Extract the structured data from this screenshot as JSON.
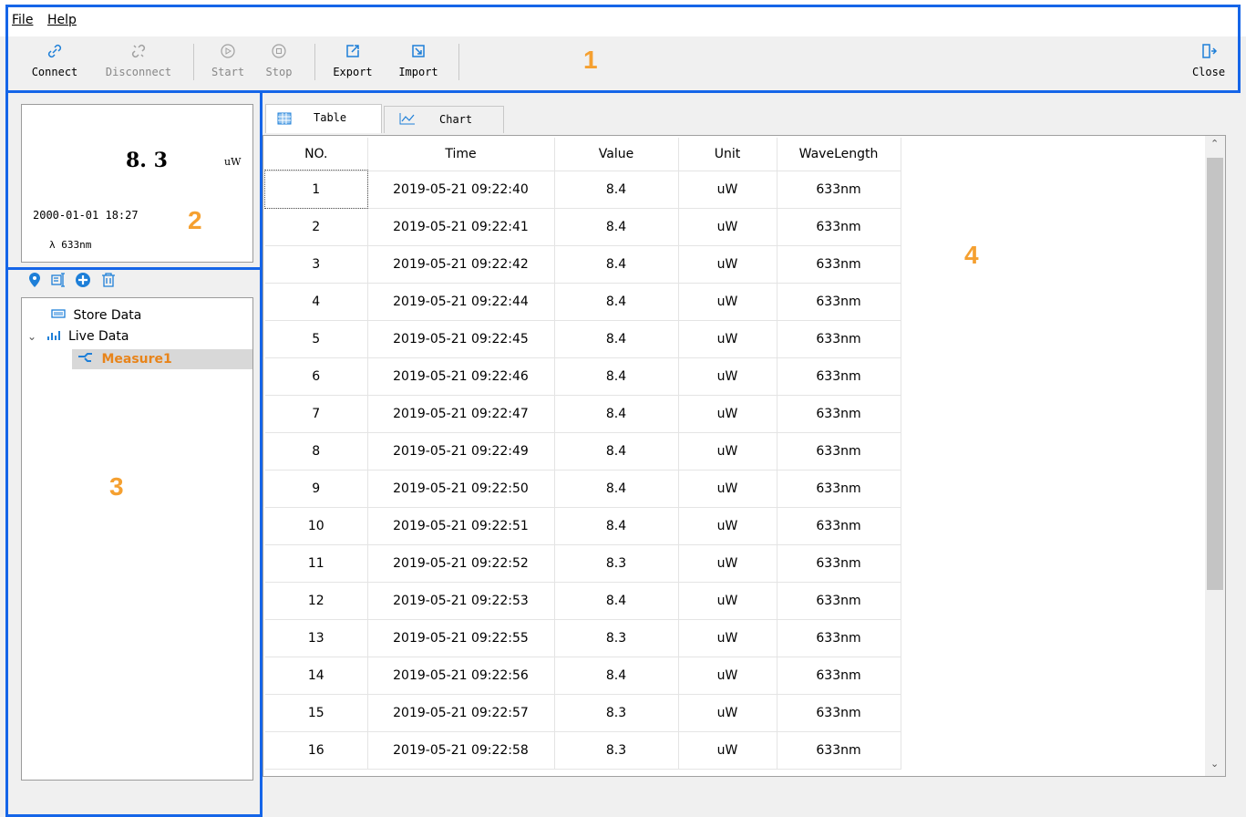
{
  "menu": {
    "file": "File",
    "help": "Help"
  },
  "toolbar": {
    "connect": "Connect",
    "disconnect": "Disconnect",
    "start": "Start",
    "stop": "Stop",
    "export": "Export",
    "import": "Import",
    "close": "Close"
  },
  "annotations": [
    "1",
    "2",
    "3",
    "4"
  ],
  "reading": {
    "value": "8. 3",
    "unit": "uW",
    "datetime": "2000-01-01 18:27",
    "wavelength": "633nm"
  },
  "tree": {
    "store": "Store Data",
    "live": "Live Data",
    "measure": "Measure1"
  },
  "tabs": {
    "table": "Table",
    "chart": "Chart"
  },
  "table": {
    "headers": [
      "NO.",
      "Time",
      "Value",
      "Unit",
      "WaveLength"
    ],
    "rows": [
      [
        "1",
        "2019-05-21 09:22:40",
        "8.4",
        "uW",
        "633nm"
      ],
      [
        "2",
        "2019-05-21 09:22:41",
        "8.4",
        "uW",
        "633nm"
      ],
      [
        "3",
        "2019-05-21 09:22:42",
        "8.4",
        "uW",
        "633nm"
      ],
      [
        "4",
        "2019-05-21 09:22:44",
        "8.4",
        "uW",
        "633nm"
      ],
      [
        "5",
        "2019-05-21 09:22:45",
        "8.4",
        "uW",
        "633nm"
      ],
      [
        "6",
        "2019-05-21 09:22:46",
        "8.4",
        "uW",
        "633nm"
      ],
      [
        "7",
        "2019-05-21 09:22:47",
        "8.4",
        "uW",
        "633nm"
      ],
      [
        "8",
        "2019-05-21 09:22:49",
        "8.4",
        "uW",
        "633nm"
      ],
      [
        "9",
        "2019-05-21 09:22:50",
        "8.4",
        "uW",
        "633nm"
      ],
      [
        "10",
        "2019-05-21 09:22:51",
        "8.4",
        "uW",
        "633nm"
      ],
      [
        "11",
        "2019-05-21 09:22:52",
        "8.3",
        "uW",
        "633nm"
      ],
      [
        "12",
        "2019-05-21 09:22:53",
        "8.4",
        "uW",
        "633nm"
      ],
      [
        "13",
        "2019-05-21 09:22:55",
        "8.3",
        "uW",
        "633nm"
      ],
      [
        "14",
        "2019-05-21 09:22:56",
        "8.4",
        "uW",
        "633nm"
      ],
      [
        "15",
        "2019-05-21 09:22:57",
        "8.3",
        "uW",
        "633nm"
      ],
      [
        "16",
        "2019-05-21 09:22:58",
        "8.3",
        "uW",
        "633nm"
      ]
    ]
  },
  "colors": {
    "annotation_border": "#1565e8",
    "annotation_number": "#f5a030",
    "icon_blue": "#1e7fd8",
    "measure_orange": "#e8841a",
    "selection_gray": "#d8d8d8"
  }
}
